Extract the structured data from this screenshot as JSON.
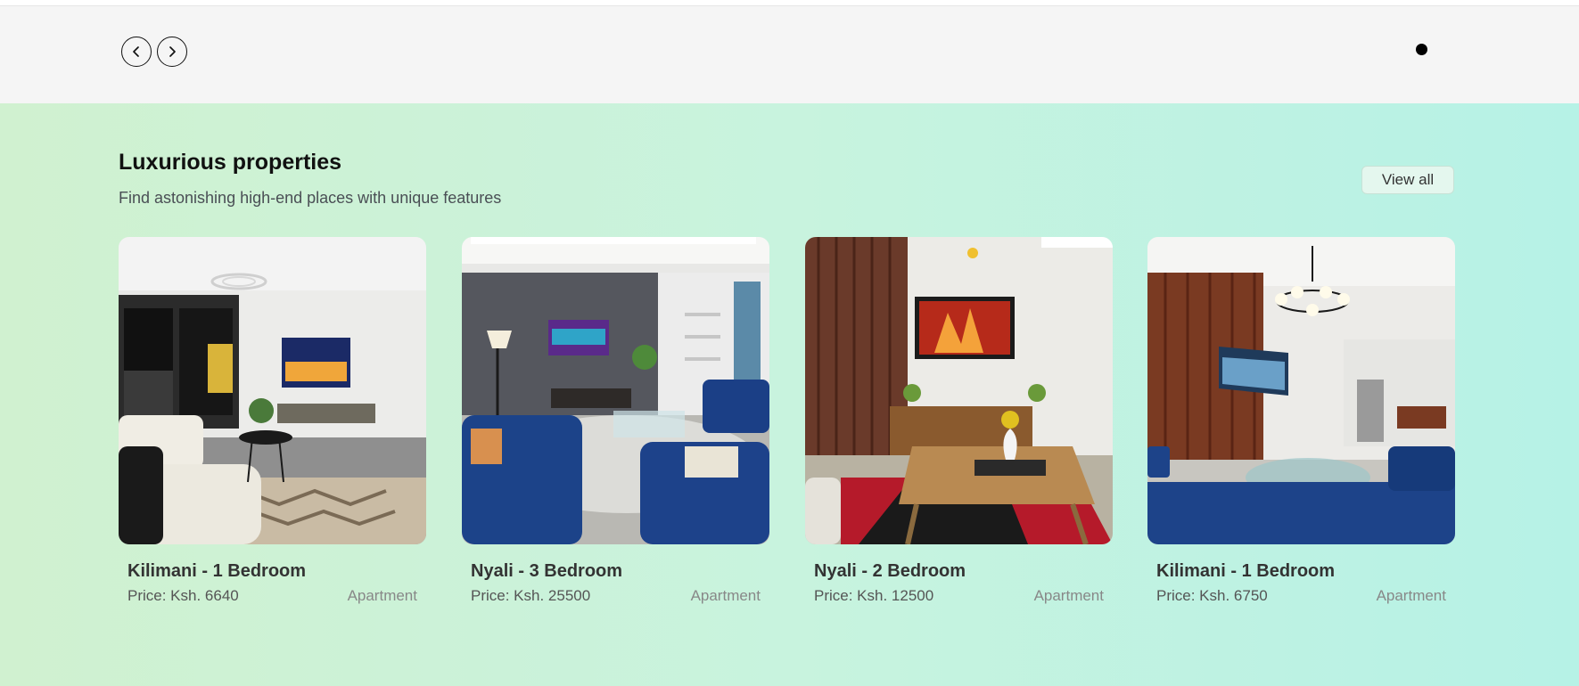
{
  "carousel": {
    "prev_label": "previous",
    "next_label": "next"
  },
  "section": {
    "title": "Luxurious properties",
    "subtitle": "Find astonishing high-end places with unique features",
    "view_all_label": "View all"
  },
  "properties": [
    {
      "name": "Kilimani - 1 Bedroom",
      "price": "Price: Ksh. 6640",
      "type": "Apartment"
    },
    {
      "name": "Nyali - 3 Bedroom",
      "price": "Price: Ksh. 25500",
      "type": "Apartment"
    },
    {
      "name": "Nyali - 2 Bedroom",
      "price": "Price: Ksh. 12500",
      "type": "Apartment"
    },
    {
      "name": "Kilimani - 1 Bedroom",
      "price": "Price: Ksh. 6750",
      "type": "Apartment"
    }
  ],
  "colors": {
    "gradient_start": "#d0f1d0",
    "gradient_end": "#b6f2e6",
    "bar_background": "#f5f5f5"
  },
  "icons": {
    "prev": "chevron-left-icon",
    "next": "chevron-right-icon",
    "pagination": "dot-indicator"
  }
}
